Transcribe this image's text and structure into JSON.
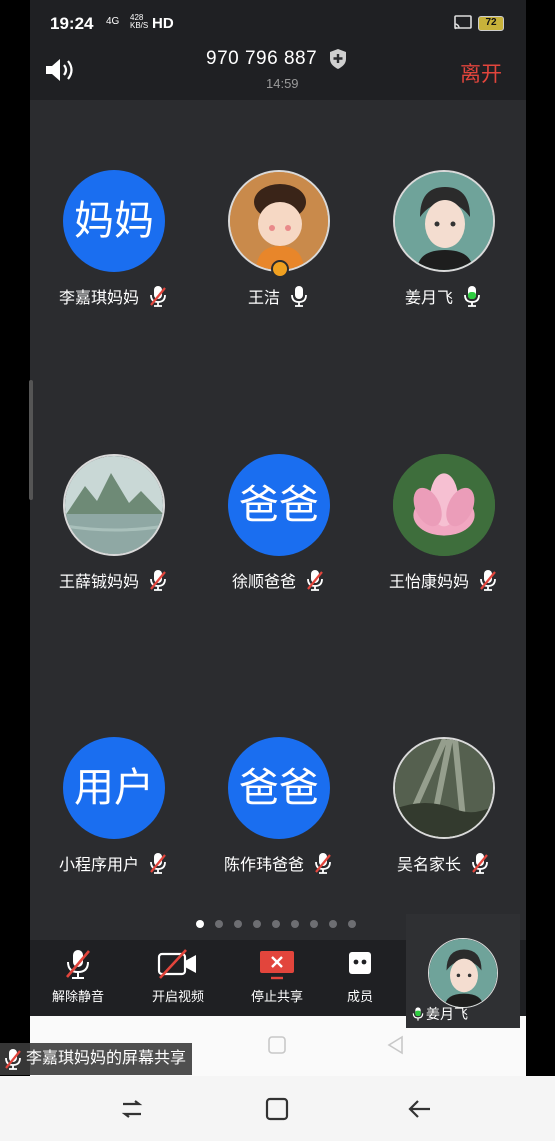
{
  "status_bar": {
    "time": "19:24",
    "network": "4G",
    "speed_value": "428",
    "speed_unit": "KB/S",
    "hd": "HD",
    "battery": "72"
  },
  "header": {
    "meeting_id": "970 796 887",
    "timer": "14:59",
    "leave_label": "离开"
  },
  "participants": [
    {
      "name": "李嘉琪妈妈",
      "avatar_text": "妈妈",
      "avatar_type": "text",
      "mic": "muted"
    },
    {
      "name": "王洁",
      "avatar_text": "",
      "avatar_type": "cartoon",
      "mic": "on",
      "host": true
    },
    {
      "name": "姜月飞",
      "avatar_text": "",
      "avatar_type": "anime-boy",
      "mic": "speaking"
    },
    {
      "name": "王薛铖妈妈",
      "avatar_text": "",
      "avatar_type": "landscape",
      "mic": "muted"
    },
    {
      "name": "徐顺爸爸",
      "avatar_text": "爸爸",
      "avatar_type": "text",
      "mic": "muted"
    },
    {
      "name": "王怡康妈妈",
      "avatar_text": "",
      "avatar_type": "lotus",
      "mic": "muted"
    },
    {
      "name": "小程序用户",
      "avatar_text": "用户",
      "avatar_type": "text",
      "mic": "muted"
    },
    {
      "name": "陈作玮爸爸",
      "avatar_text": "爸爸",
      "avatar_type": "text",
      "mic": "muted"
    },
    {
      "name": "吴名家长",
      "avatar_text": "",
      "avatar_type": "sunrays",
      "mic": "muted"
    }
  ],
  "page_dots": {
    "count": 9,
    "active_index": 0
  },
  "toolbar": {
    "unmute_label": "解除静音",
    "video_label": "开启视频",
    "stop_share_label": "停止共享",
    "members_label": "成员"
  },
  "mini_video": {
    "name": "姜月飞"
  },
  "share_banner": {
    "text": "李嘉琪妈妈的屏幕共享"
  },
  "colors": {
    "accent_blue": "#1a6ef0",
    "leave_red": "#e2453c",
    "mic_green": "#2ecc40",
    "mute_red": "#e2453c"
  }
}
